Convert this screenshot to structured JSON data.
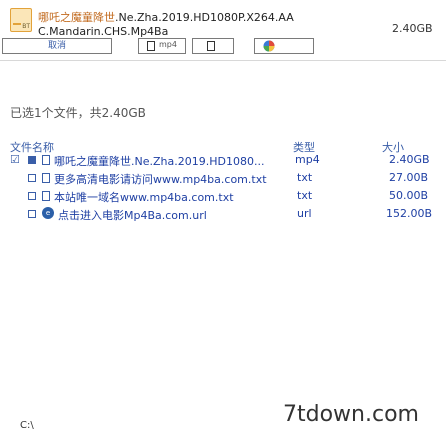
{
  "header": {
    "title_line1_cn": "哪吒之魔童降世",
    "title_line1_rest": ".Ne.Zha.2019.HD1080P.X264.AA",
    "title_line2": "C.Mandarin.CHS.Mp4Ba",
    "size": "2.40GB",
    "icon_tag": "BT"
  },
  "toolbar": {
    "select_all": "取消",
    "filter_ext": "mp4",
    "icon": "color-wheel-icon"
  },
  "summary": "已选1个文件，共2.40GB",
  "table": {
    "col_name": "文件名称",
    "col_type": "类型",
    "col_size": "大小",
    "rows": [
      {
        "name": "哪吒之魔童降世.Ne.Zha.2019.HD1080...",
        "type": "mp4",
        "size": "2.40GB",
        "checked": true,
        "icon": "file-icon"
      },
      {
        "name": "更多高清电影请访问www.mp4ba.com.txt",
        "type": "txt",
        "size": "27.00B",
        "checked": false,
        "icon": "file-icon"
      },
      {
        "name": "本站唯一域名www.mp4ba.com.txt",
        "type": "txt",
        "size": "50.00B",
        "checked": false,
        "icon": "file-icon"
      },
      {
        "name": "点击进入电影Mp4Ba.com.url",
        "type": "url",
        "size": "152.00B",
        "checked": false,
        "icon": "web-icon"
      }
    ]
  },
  "footer": {
    "path": "C:\\",
    "watermark": "7tdown.com"
  }
}
